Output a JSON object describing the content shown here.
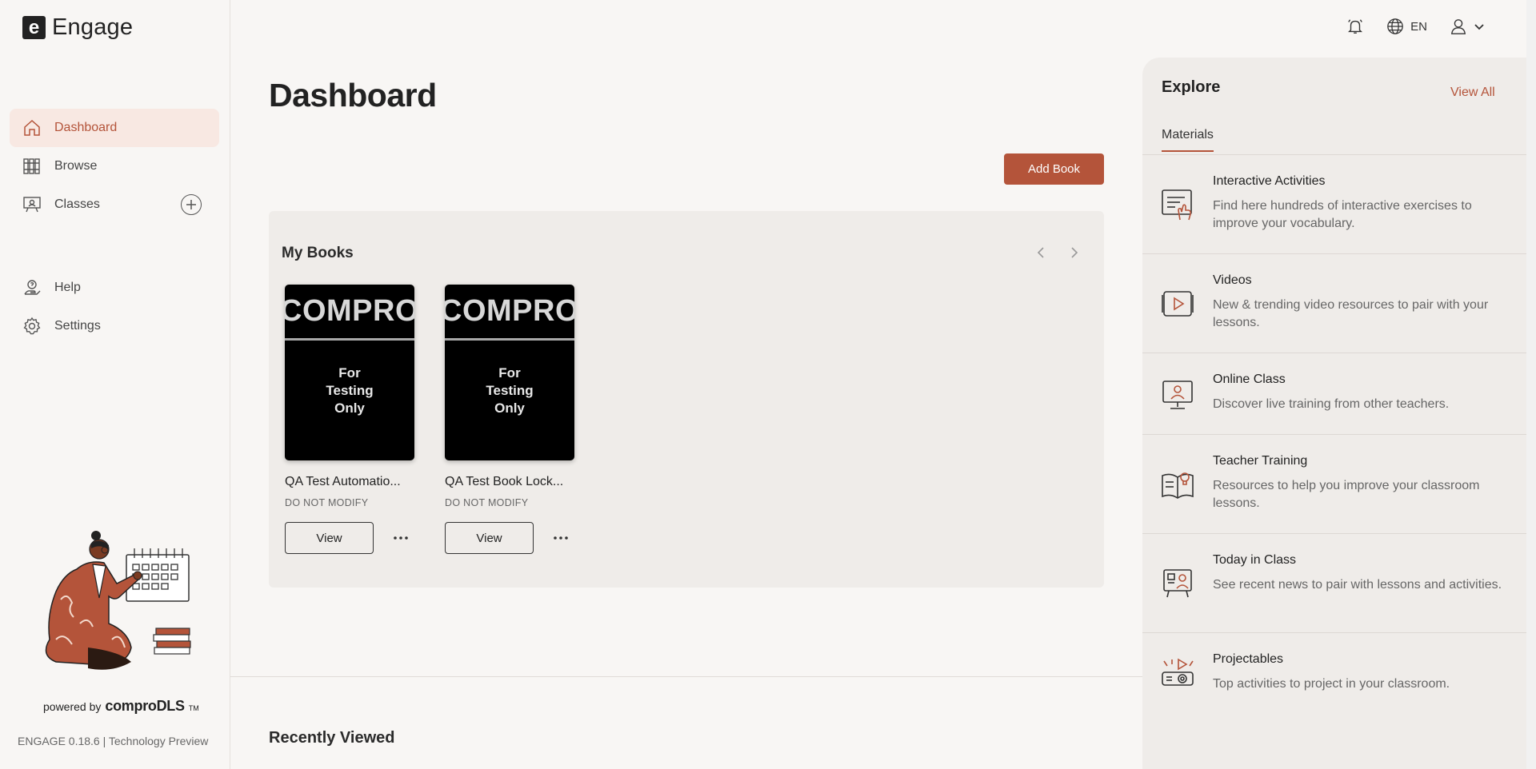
{
  "app": {
    "name": "Engage",
    "logo_letter": "e"
  },
  "sidebar": {
    "items": [
      {
        "label": "Dashboard",
        "icon": "home-icon",
        "active": true
      },
      {
        "label": "Browse",
        "icon": "books-icon"
      },
      {
        "label": "Classes",
        "icon": "classroom-icon"
      },
      {
        "label": "Help",
        "icon": "help-icon"
      },
      {
        "label": "Settings",
        "icon": "gear-icon"
      }
    ],
    "powered_by": "powered by",
    "brand": "comproDLS",
    "trademark": "TM",
    "version": "ENGAGE 0.18.6 | Technology Preview"
  },
  "topbar": {
    "language": "EN"
  },
  "main": {
    "title": "Dashboard",
    "add_book_label": "Add Book",
    "my_books": {
      "title": "My Books",
      "books": [
        {
          "cover_brand": "COMPRO",
          "cover_text": "For Testing Only",
          "title": "QA Test Automatio...",
          "subtitle": "DO NOT MODIFY",
          "view_label": "View"
        },
        {
          "cover_brand": "COMPRO",
          "cover_text": "For Testing Only",
          "title": "QA Test Book Lock...",
          "subtitle": "DO NOT MODIFY",
          "view_label": "View"
        }
      ]
    },
    "recently_viewed_title": "Recently Viewed"
  },
  "explore": {
    "title": "Explore",
    "view_all": "View All",
    "tab": "Materials",
    "items": [
      {
        "title": "Interactive Activities",
        "desc": "Find here hundreds of interactive exercises to improve your vocabulary.",
        "icon": "interactive-activities-icon"
      },
      {
        "title": "Videos",
        "desc": "New & trending video resources to pair with your lessons.",
        "icon": "video-icon"
      },
      {
        "title": "Online Class",
        "desc": "Discover live training from other teachers.",
        "icon": "online-class-icon"
      },
      {
        "title": "Teacher Training",
        "desc": "Resources to help you improve your classroom lessons.",
        "icon": "teacher-training-icon"
      },
      {
        "title": "Today in Class",
        "desc": "See recent news to pair with lessons and activities.",
        "icon": "today-in-class-icon"
      },
      {
        "title": "Projectables",
        "desc": "Top activities to project in your classroom.",
        "icon": "projector-icon"
      }
    ]
  },
  "colors": {
    "accent": "#b4543a",
    "active_bg": "#f8e8e2",
    "panel_bg": "#efece9",
    "page_bg": "#f8f6f4"
  }
}
